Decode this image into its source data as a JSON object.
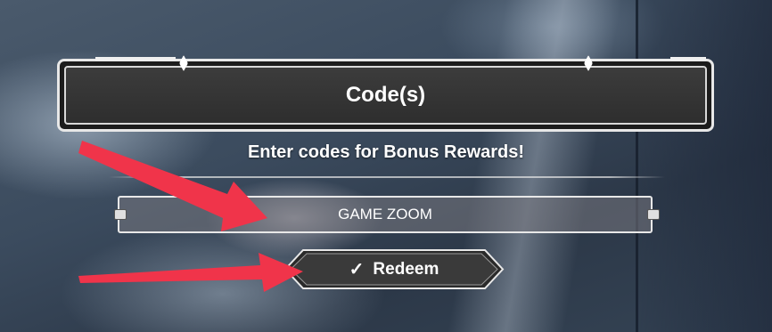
{
  "dialog": {
    "title": "Code(s)",
    "subtitle": "Enter codes for Bonus Rewards!"
  },
  "code_input": {
    "value": "GAME ZOOM"
  },
  "redeem_button": {
    "icon": "check-icon",
    "icon_glyph": "✓",
    "label": "Redeem"
  },
  "annotations": {
    "arrow_color": "#f0344a"
  }
}
